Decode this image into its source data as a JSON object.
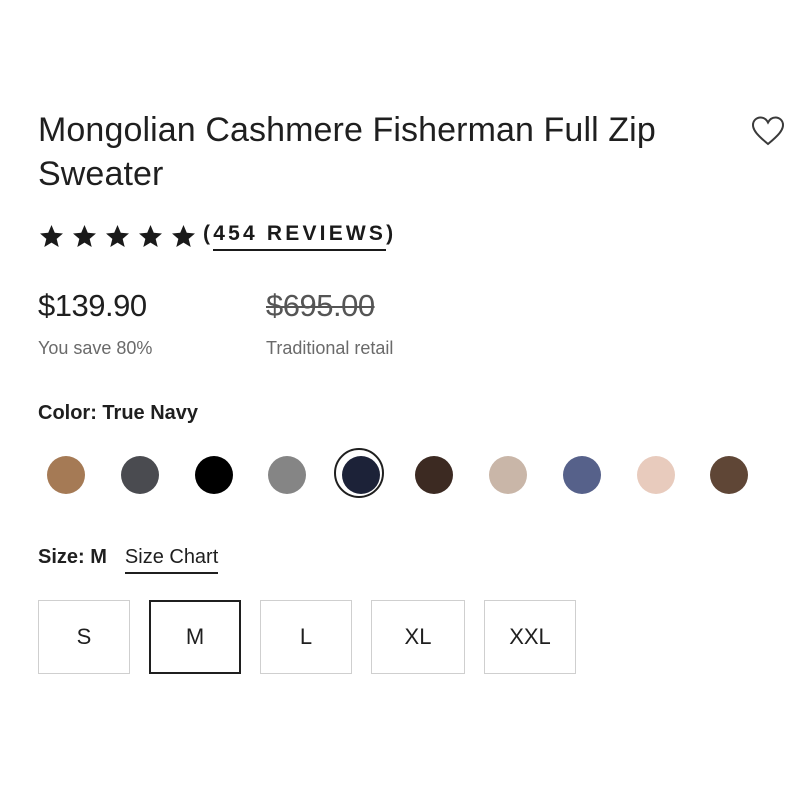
{
  "product": {
    "title": "Mongolian Cashmere Fisherman Full Zip Sweater",
    "rating": 5,
    "reviews_label": "454 REVIEWS"
  },
  "pricing": {
    "current_price": "$139.90",
    "savings_text": "You save 80%",
    "original_price": "$695.00",
    "original_label": "Traditional retail"
  },
  "color": {
    "label": "Color: True Navy",
    "swatches": [
      {
        "color": "#a57a55"
      },
      {
        "color": "#4a4b50"
      },
      {
        "color": "#000000"
      },
      {
        "color": "#858585"
      },
      {
        "color": "#1c2238",
        "selected": true
      },
      {
        "color": "#3c2a22"
      },
      {
        "color": "#c9b6a8"
      },
      {
        "color": "#56618a"
      },
      {
        "color": "#e8cbbd"
      },
      {
        "color": "#5f4636"
      }
    ]
  },
  "size": {
    "label": "Size: M",
    "chart_link": "Size Chart",
    "options": [
      {
        "label": "S"
      },
      {
        "label": "M",
        "selected": true
      },
      {
        "label": "L"
      },
      {
        "label": "XL"
      },
      {
        "label": "XXL"
      }
    ]
  },
  "icons": {
    "wishlist": "heart-outline-icon",
    "rating": "star-icon"
  }
}
